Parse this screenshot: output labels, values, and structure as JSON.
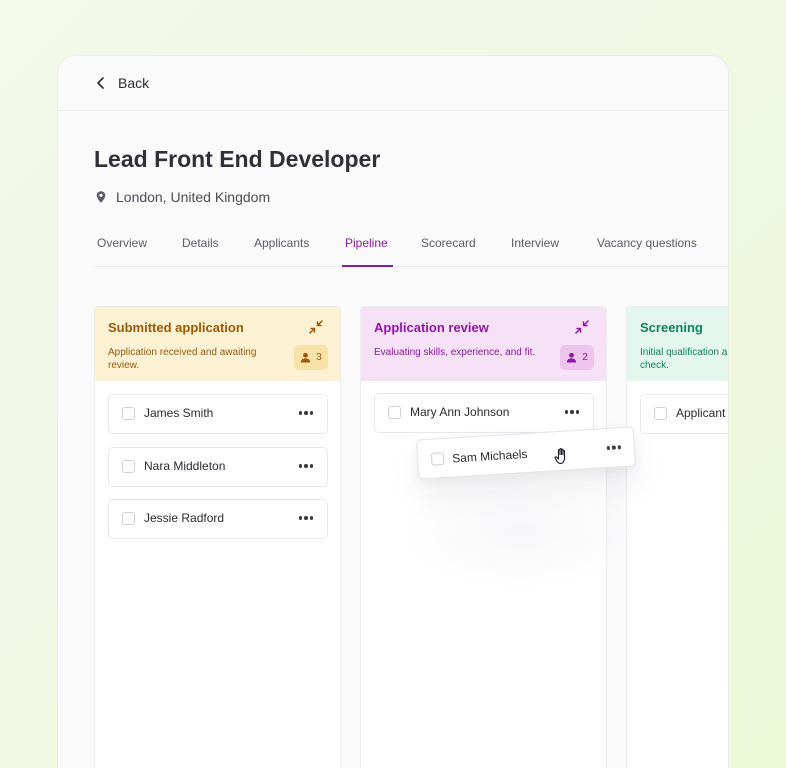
{
  "nav": {
    "back_label": "Back"
  },
  "job": {
    "title": "Lead Front End Developer",
    "location": "London, United Kingdom"
  },
  "tabs": [
    {
      "label": "Overview",
      "active": false
    },
    {
      "label": "Details",
      "active": false
    },
    {
      "label": "Applicants",
      "active": false
    },
    {
      "label": "Pipeline",
      "active": true
    },
    {
      "label": "Scorecard",
      "active": false
    },
    {
      "label": "Interview",
      "active": false
    },
    {
      "label": "Vacancy questions",
      "active": false
    }
  ],
  "colors": {
    "accent": "#8d1aa3",
    "submitted_bg": "#fdf1d4",
    "submitted_text": "#9a5b08",
    "submitted_badge": "#f8e2a8",
    "review_bg": "#f6e1f6",
    "review_text": "#8d1aa3",
    "review_badge": "#ecc4ec",
    "screening_bg": "#e3f7ef",
    "screening_text": "#12825a"
  },
  "columns": [
    {
      "title": "Submitted application",
      "description": "Application received and awaiting review.",
      "count": "3",
      "cards": [
        {
          "name": "James Smith"
        },
        {
          "name": "Nara Middleton"
        },
        {
          "name": "Jessie Radford"
        }
      ]
    },
    {
      "title": "Application review",
      "description": "Evaluating skills, experience, and fit.",
      "count": "2",
      "cards": [
        {
          "name": "Mary Ann Johnson"
        }
      ]
    },
    {
      "title": "Screening",
      "description": "Initial qualification a check.",
      "count": "",
      "cards": [
        {
          "name": "Applicant"
        }
      ]
    }
  ],
  "dragging_card": {
    "name": "Sam Michaels"
  },
  "icons": {
    "back": "chevron-left-icon",
    "location": "map-pin-icon",
    "collapse": "collapse-arrows-icon",
    "count": "person-icon",
    "more": "more-dots-icon",
    "cursor": "grab-hand-icon"
  }
}
